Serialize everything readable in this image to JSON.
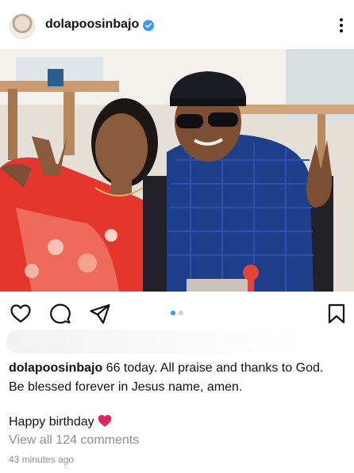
{
  "post": {
    "username": "dolapoosinbajo",
    "verified_icon": "verified-badge-icon",
    "more_icon": "more-options-icon"
  },
  "actions": {
    "like_icon": "heart-icon",
    "comment_icon": "comment-icon",
    "share_icon": "send-icon",
    "save_icon": "bookmark-icon",
    "carousel_total": 2,
    "carousel_current": 1
  },
  "caption": {
    "username": "dolapoosinbajo",
    "text_line1": " 66 today. All praise and thanks to God.",
    "text_line2": "Be blessed forever in Jesus name, amen.",
    "text_line3": "Happy birthday",
    "emoji": "red-heart-emoji"
  },
  "comments": {
    "view_all": "View all 124 comments"
  },
  "timestamp": "43 minutes ago",
  "colors": {
    "accent_blue": "#3897f0",
    "verified_blue": "#3897f0",
    "muted_text": "#8e8e8e",
    "heart_red": "#e0245e"
  }
}
